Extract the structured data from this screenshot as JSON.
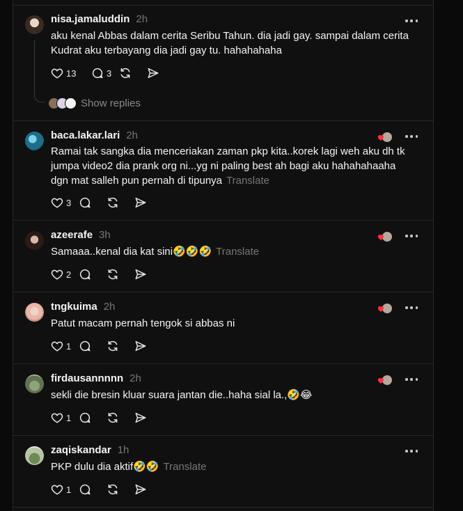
{
  "colors": {
    "background": "#101010",
    "text": "#f3f5f7",
    "muted": "#777777",
    "heart": "#ff3040"
  },
  "icons": [
    "heart-icon",
    "comment-icon",
    "repost-icon",
    "share-icon",
    "more-icon"
  ],
  "show_replies_label": "Show replies",
  "translate_label": "Translate",
  "posts": [
    {
      "username": "nisa.jamaluddin",
      "time": "2h",
      "text": "aku kenal Abbas dalam cerita Seribu Tahun. dia jadi gay. sampai dalam cerita Kudrat aku terbayang dia jadi gay tu. hahahahaha",
      "likes": "13",
      "comments": "3"
    },
    {
      "username": "baca.lakar.lari",
      "time": "2h",
      "text": "Ramai tak sangka dia menceriakan zaman pkp kita..korek lagi weh aku dh tk jumpa video2 dia prank org ni...yg ni paling best ah bagi aku hahahahaaha dgn mat salleh pun pernah di tipunya",
      "likes": "3",
      "comments": ""
    },
    {
      "username": "azeerafe",
      "time": "3h",
      "text": "Samaaa..kenal dia kat sini🤣🤣🤣",
      "likes": "2",
      "comments": ""
    },
    {
      "username": "tngkuima",
      "time": "2h",
      "text": "Patut macam pernah tengok si abbas ni",
      "likes": "1",
      "comments": ""
    },
    {
      "username": "firdausannnnn",
      "time": "2h",
      "text": "sekli die bresin kluar suara jantan die..haha sial la.,🤣😂",
      "likes": "1",
      "comments": ""
    },
    {
      "username": "zaqiskandar",
      "time": "1h",
      "text": "PKP dulu dia aktif🤣🤣",
      "likes": "1",
      "comments": ""
    }
  ]
}
